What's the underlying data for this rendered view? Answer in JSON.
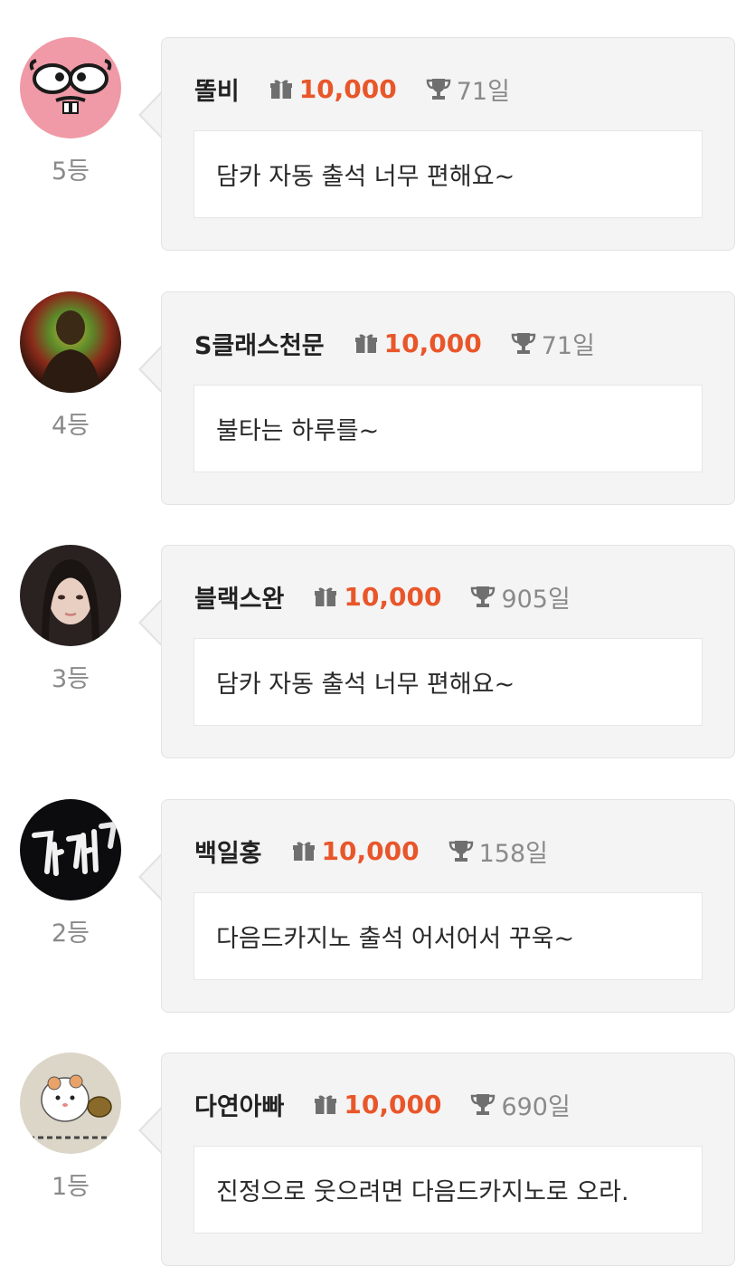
{
  "colors": {
    "points": "#e8562a",
    "muted": "#8a8a8a",
    "bubble_bg": "#f4f4f4"
  },
  "entries": [
    {
      "avatar": "pink-cartoon-face",
      "rank": "5등",
      "nickname": "똘비",
      "gift_icon": "gift-icon",
      "points": "10,000",
      "trophy_icon": "trophy-icon",
      "days": "71일",
      "message": "담카 자동 출석 너무 편해요~"
    },
    {
      "avatar": "dark-portrait-glow",
      "rank": "4등",
      "nickname": "S클래스천문",
      "gift_icon": "gift-icon",
      "points": "10,000",
      "trophy_icon": "trophy-icon",
      "days": "71일",
      "message": "불타는 하루를~"
    },
    {
      "avatar": "woman-portrait",
      "rank": "3등",
      "nickname": "블랙스완",
      "gift_icon": "gift-icon",
      "points": "10,000",
      "trophy_icon": "trophy-icon",
      "days": "905일",
      "message": "담카 자동 출석 너무 편해요~"
    },
    {
      "avatar": "night-neon-sign",
      "rank": "2등",
      "nickname": "백일홍",
      "gift_icon": "gift-icon",
      "points": "10,000",
      "trophy_icon": "trophy-icon",
      "days": "158일",
      "message": "다음드카지노 출석 어서어서 꾸욱~"
    },
    {
      "avatar": "hamster-drawing",
      "rank": "1등",
      "nickname": "다연아빠",
      "gift_icon": "gift-icon",
      "points": "10,000",
      "trophy_icon": "trophy-icon",
      "days": "690일",
      "message": "진정으로 웃으려면 다음드카지노로 오라."
    }
  ]
}
